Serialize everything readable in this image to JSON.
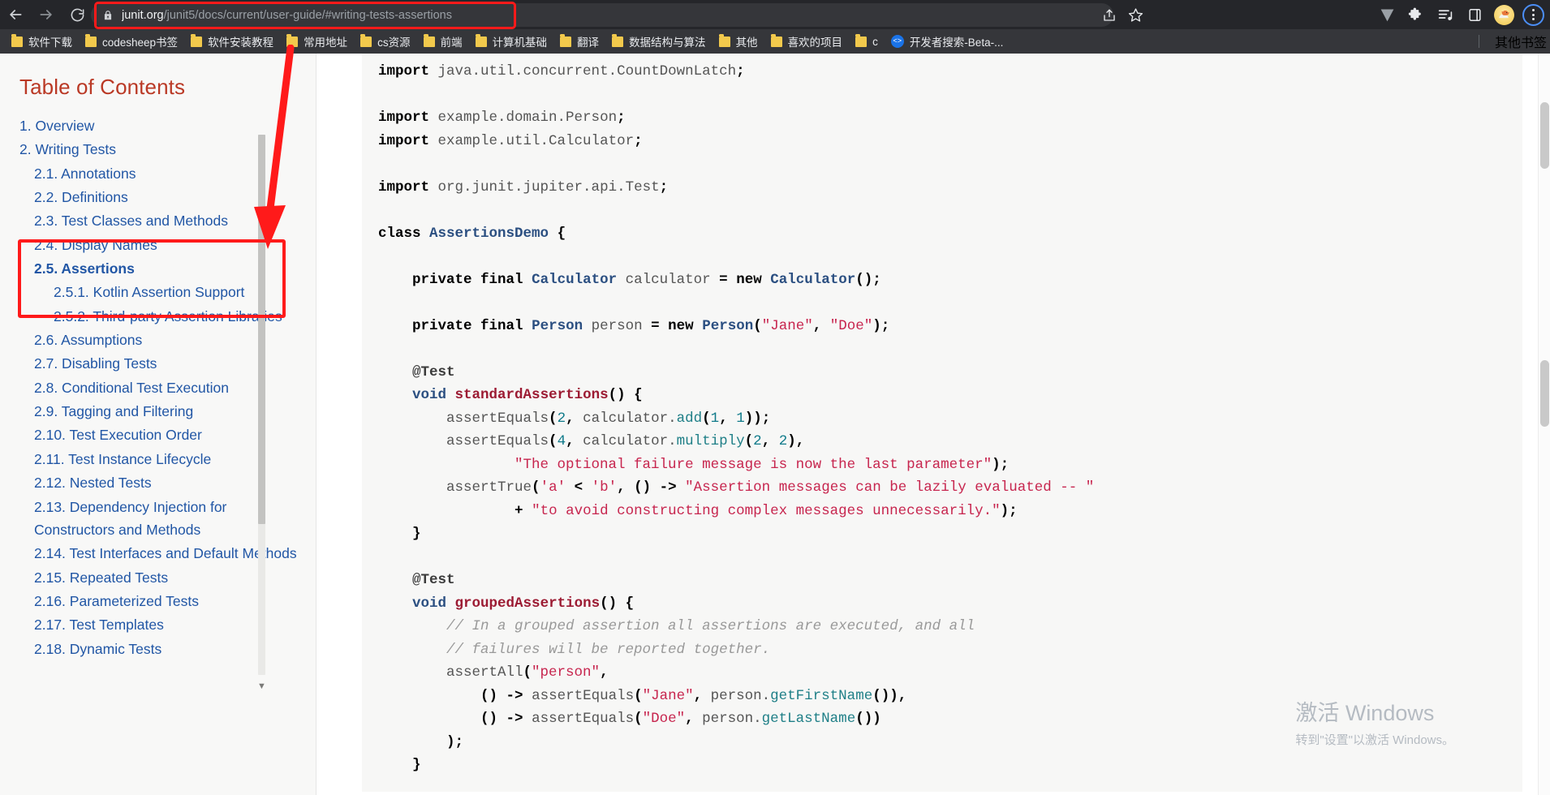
{
  "browser": {
    "nav": {
      "back_label": "Back",
      "forward_label": "Forward",
      "reload_label": "Reload"
    },
    "omnibox": {
      "lock_icon": "lock-icon",
      "host": "junit.org",
      "path": "/junit5/docs/current/user-guide/#writing-tests-assertions",
      "full_url": "junit.org/junit5/docs/current/user-guide/#writing-tests-assertions",
      "share_icon": "share-icon",
      "bookmark_icon": "star-icon"
    },
    "toolbar_icons": [
      "vimium-v-icon",
      "extensions-puzzle-icon",
      "media-playlist-icon",
      "side-panel-icon",
      "profile-avatar-icon",
      "three-dot-menu-icon"
    ],
    "bookmarks": [
      {
        "label": "软件下载",
        "icon": "folder-icon"
      },
      {
        "label": "codesheep书签",
        "icon": "folder-icon"
      },
      {
        "label": "软件安装教程",
        "icon": "folder-icon"
      },
      {
        "label": "常用地址",
        "icon": "folder-icon"
      },
      {
        "label": "cs资源",
        "icon": "folder-icon"
      },
      {
        "label": "前端",
        "icon": "folder-icon"
      },
      {
        "label": "计算机基础",
        "icon": "folder-icon"
      },
      {
        "label": "翻译",
        "icon": "folder-icon"
      },
      {
        "label": "数据结构与算法",
        "icon": "folder-icon"
      },
      {
        "label": "其他",
        "icon": "folder-icon"
      },
      {
        "label": "喜欢的项目",
        "icon": "folder-icon"
      },
      {
        "label": "c",
        "icon": "folder-icon"
      },
      {
        "label": "开发者搜索-Beta-...",
        "icon": "dev-search-icon"
      }
    ],
    "bookmarks_overflow": {
      "label": "其他书签",
      "icon": "folder-icon"
    }
  },
  "toc": {
    "title": "Table of Contents",
    "items": [
      {
        "label": "1. Overview",
        "level": 1,
        "active": false
      },
      {
        "label": "2. Writing Tests",
        "level": 1,
        "active": false
      },
      {
        "label": "2.1. Annotations",
        "level": 2,
        "active": false
      },
      {
        "label": "2.2. Definitions",
        "level": 2,
        "active": false
      },
      {
        "label": "2.3. Test Classes and Methods",
        "level": 2,
        "active": false
      },
      {
        "label": "2.4. Display Names",
        "level": 2,
        "active": false
      },
      {
        "label": "2.5. Assertions",
        "level": 2,
        "active": true
      },
      {
        "label": "2.5.1. Kotlin Assertion Support",
        "level": 3,
        "active": false
      },
      {
        "label": "2.5.2. Third-party Assertion Libraries",
        "level": 3,
        "active": false
      },
      {
        "label": "2.6. Assumptions",
        "level": 2,
        "active": false
      },
      {
        "label": "2.7. Disabling Tests",
        "level": 2,
        "active": false
      },
      {
        "label": "2.8. Conditional Test Execution",
        "level": 2,
        "active": false
      },
      {
        "label": "2.9. Tagging and Filtering",
        "level": 2,
        "active": false
      },
      {
        "label": "2.10. Test Execution Order",
        "level": 2,
        "active": false
      },
      {
        "label": "2.11. Test Instance Lifecycle",
        "level": 2,
        "active": false
      },
      {
        "label": "2.12. Nested Tests",
        "level": 2,
        "active": false
      },
      {
        "label": "2.13. Dependency Injection for Constructors and Methods",
        "level": 2,
        "active": false
      },
      {
        "label": "2.14. Test Interfaces and Default Methods",
        "level": 2,
        "active": false
      },
      {
        "label": "2.15. Repeated Tests",
        "level": 2,
        "active": false
      },
      {
        "label": "2.16. Parameterized Tests",
        "level": 2,
        "active": false
      },
      {
        "label": "2.17. Test Templates",
        "level": 2,
        "active": false
      },
      {
        "label": "2.18. Dynamic Tests",
        "level": 2,
        "active": false
      }
    ]
  },
  "annotations": {
    "url_box": {
      "shape": "rounded-rectangle",
      "color": "#ff1a1a"
    },
    "arrow": {
      "shape": "arrow",
      "color": "#ff1a1a",
      "from": "url-bar",
      "to": "toc-assertions"
    },
    "toc_box": {
      "shape": "rectangle",
      "color": "#ff1a1a",
      "target": "2.5. Assertions"
    }
  },
  "code": {
    "language": "java",
    "lines": [
      "import java.util.concurrent.CountDownLatch;",
      "",
      "import example.domain.Person;",
      "import example.util.Calculator;",
      "",
      "import org.junit.jupiter.api.Test;",
      "",
      "class AssertionsDemo {",
      "",
      "    private final Calculator calculator = new Calculator();",
      "",
      "    private final Person person = new Person(\"Jane\", \"Doe\");",
      "",
      "    @Test",
      "    void standardAssertions() {",
      "        assertEquals(2, calculator.add(1, 1));",
      "        assertEquals(4, calculator.multiply(2, 2),",
      "                \"The optional failure message is now the last parameter\");",
      "        assertTrue('a' < 'b', () -> \"Assertion messages can be lazily evaluated -- \"",
      "                + \"to avoid constructing complex messages unnecessarily.\");",
      "    }",
      "",
      "    @Test",
      "    void groupedAssertions() {",
      "        // In a grouped assertion all assertions are executed, and all",
      "        // failures will be reported together.",
      "        assertAll(\"person\",",
      "            () -> assertEquals(\"Jane\", person.getFirstName()),",
      "            () -> assertEquals(\"Doe\", person.getLastName())",
      "        );",
      "    }"
    ]
  },
  "watermark": {
    "line1": "激活 Windows",
    "line2": "转到\"设置\"以激活 Windows。"
  },
  "colors": {
    "annotation_red": "#ff1a1a",
    "toc_link": "#2156a5",
    "toc_title": "#ba3925",
    "code_bg": "#f7f7f6",
    "string": "#c7254e",
    "number": "#0f7a8a",
    "comment": "#999999",
    "chrome_bg": "#25262a"
  }
}
